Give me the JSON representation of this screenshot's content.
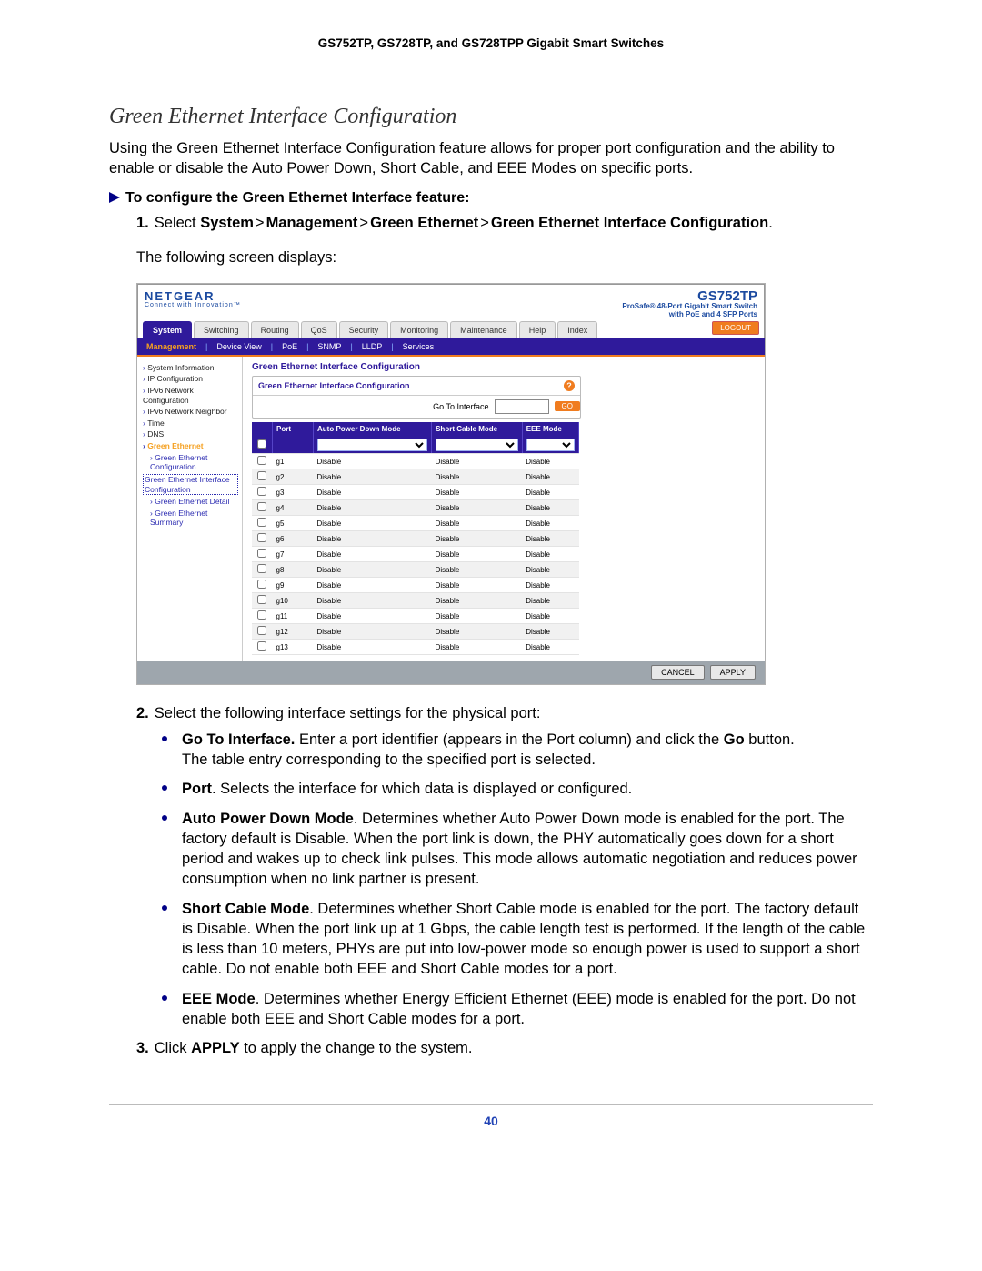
{
  "doc_header": "GS752TP, GS728TP, and GS728TPP Gigabit Smart Switches",
  "section_title": "Green Ethernet Interface Configuration",
  "intro": "Using the Green Ethernet Interface Configuration feature allows for proper port configuration and the ability to enable or disable the Auto Power Down, Short Cable, and EEE Modes on specific ports.",
  "proc_title": "To configure the Green Ethernet Interface feature:",
  "step1_pre": "Select ",
  "step1_path": [
    "System",
    "Management",
    "Green Ethernet",
    "Green Ethernet Interface Configuration"
  ],
  "step1_post": ".",
  "screen_caption": "The following screen displays:",
  "step2": "Select the following interface settings for the physical port:",
  "bullets": {
    "goto_h": "Go To Interface.",
    "goto_t": " Enter a port identifier (appears in the Port column) and click the ",
    "goto_go": "Go",
    "goto_t2": " button.",
    "goto_line2": "The table entry corresponding to the specified port is selected.",
    "port_h": "Port",
    "port_t": ". Selects the interface for which data is displayed or configured.",
    "apd_h": "Auto Power Down Mode",
    "apd_t": ". Determines whether Auto Power Down mode is enabled for the port. The factory default is Disable. When the port link is down, the PHY automatically goes down for a short period and wakes up to check link pulses. This mode allows automatic negotiation and reduces power consumption when no link partner is present.",
    "sc_h": "Short Cable Mode",
    "sc_t": ". Determines whether Short Cable mode is enabled for the port. The factory default is Disable. When the port link up at 1 Gbps, the cable length test is performed. If the length of the cable is less than 10 meters, PHYs are put into low-power mode so enough power is used to support a short cable. Do not enable both EEE and Short Cable modes for a port.",
    "eee_h": "EEE Mode",
    "eee_t": ". Determines whether Energy Efficient Ethernet (EEE) mode is enabled for the port. Do not enable both EEE and Short Cable modes for a port."
  },
  "step3_pre": "Click ",
  "step3_b": "APPLY",
  "step3_post": " to apply the change to the system.",
  "page_number": "40",
  "ui": {
    "brand": "NETGEAR",
    "brand_sub": "Connect with Innovation™",
    "model": "GS752TP",
    "model_sub1": "ProSafe® 48-Port Gigabit Smart Switch",
    "model_sub2": "with PoE and 4 SFP Ports",
    "logout": "LOGOUT",
    "nav1": [
      "System",
      "Switching",
      "Routing",
      "QoS",
      "Security",
      "Monitoring",
      "Maintenance",
      "Help",
      "Index"
    ],
    "nav1_selected": 0,
    "nav2": [
      "Management",
      "Device View",
      "PoE",
      "SNMP",
      "LLDP",
      "Services"
    ],
    "nav2_selected": 0,
    "side": {
      "items": [
        {
          "label": "System Information",
          "cls": "top sbul"
        },
        {
          "label": "IP Configuration",
          "cls": "top sbul"
        },
        {
          "label": "IPv6 Network Configuration",
          "cls": "top sbul"
        },
        {
          "label": "IPv6 Network Neighbor",
          "cls": "top sbul"
        },
        {
          "label": "Time",
          "cls": "top sbul"
        },
        {
          "label": "DNS",
          "cls": "top sbul"
        },
        {
          "label": "Green Ethernet",
          "cls": "hl sbul"
        },
        {
          "label": "Green Ethernet Configuration",
          "cls": "sub sbul",
          "sub": true
        },
        {
          "label": "Green Ethernet Interface Configuration",
          "cls": "sub2 box",
          "sub": true,
          "boxed": true
        },
        {
          "label": "Green Ethernet Detail",
          "cls": "sub sbul",
          "sub": true
        },
        {
          "label": "Green Ethernet Summary",
          "cls": "sub sbul",
          "sub": true
        }
      ]
    },
    "panel_title": "Green Ethernet Interface Configuration",
    "panel_sub": "Green Ethernet Interface Configuration",
    "goto_label": "Go To Interface",
    "go_btn": "GO",
    "th": [
      "",
      "Port",
      "Auto Power Down Mode",
      "Short Cable Mode",
      "EEE Mode"
    ],
    "rows": [
      [
        "g1",
        "Disable",
        "Disable",
        "Disable"
      ],
      [
        "g2",
        "Disable",
        "Disable",
        "Disable"
      ],
      [
        "g3",
        "Disable",
        "Disable",
        "Disable"
      ],
      [
        "g4",
        "Disable",
        "Disable",
        "Disable"
      ],
      [
        "g5",
        "Disable",
        "Disable",
        "Disable"
      ],
      [
        "g6",
        "Disable",
        "Disable",
        "Disable"
      ],
      [
        "g7",
        "Disable",
        "Disable",
        "Disable"
      ],
      [
        "g8",
        "Disable",
        "Disable",
        "Disable"
      ],
      [
        "g9",
        "Disable",
        "Disable",
        "Disable"
      ],
      [
        "g10",
        "Disable",
        "Disable",
        "Disable"
      ],
      [
        "g11",
        "Disable",
        "Disable",
        "Disable"
      ],
      [
        "g12",
        "Disable",
        "Disable",
        "Disable"
      ],
      [
        "g13",
        "Disable",
        "Disable",
        "Disable"
      ]
    ],
    "cancel": "CANCEL",
    "apply": "APPLY"
  }
}
